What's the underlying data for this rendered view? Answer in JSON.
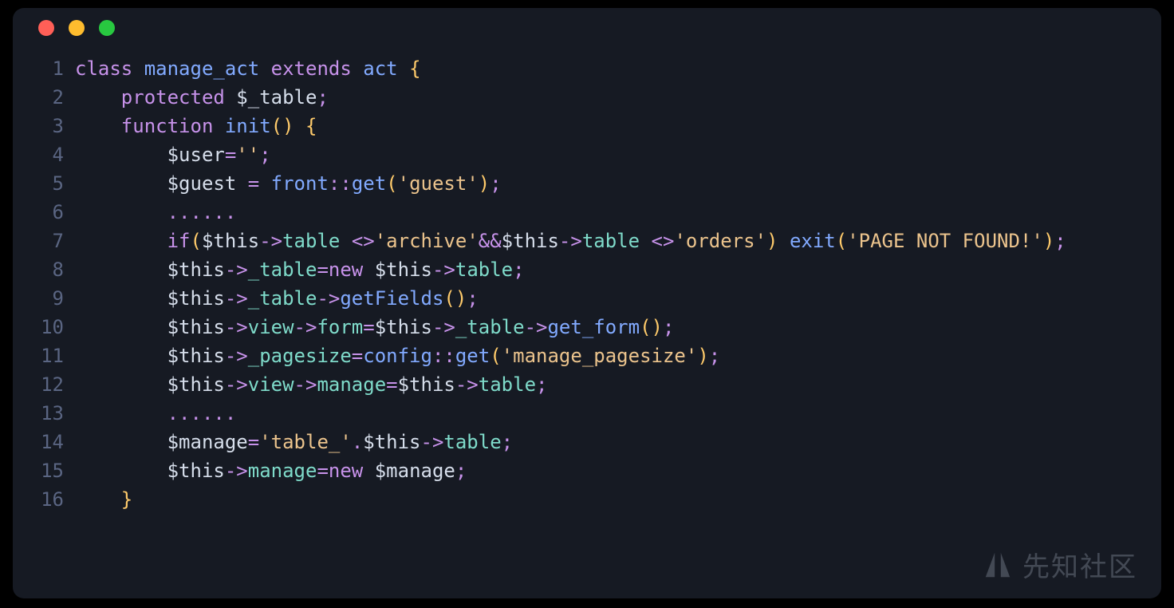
{
  "window": {
    "traffic_lights": [
      "red",
      "yellow",
      "green"
    ]
  },
  "watermark": {
    "text": "先知社区"
  },
  "code": {
    "language": "php",
    "lines": [
      {
        "n": 1,
        "indent": 0,
        "tokens": [
          {
            "c": "kw",
            "t": "class"
          },
          {
            "c": "plain",
            "t": " "
          },
          {
            "c": "name",
            "t": "manage_act"
          },
          {
            "c": "plain",
            "t": " "
          },
          {
            "c": "kw",
            "t": "extends"
          },
          {
            "c": "plain",
            "t": " "
          },
          {
            "c": "name",
            "t": "act"
          },
          {
            "c": "plain",
            "t": " "
          },
          {
            "c": "punct",
            "t": "{"
          }
        ]
      },
      {
        "n": 2,
        "indent": 1,
        "tokens": [
          {
            "c": "kw",
            "t": "protected"
          },
          {
            "c": "plain",
            "t": " "
          },
          {
            "c": "var",
            "t": "$_table"
          },
          {
            "c": "op",
            "t": ";"
          }
        ]
      },
      {
        "n": 3,
        "indent": 1,
        "tokens": [
          {
            "c": "kw",
            "t": "function"
          },
          {
            "c": "plain",
            "t": " "
          },
          {
            "c": "mname",
            "t": "init"
          },
          {
            "c": "punct",
            "t": "()"
          },
          {
            "c": "plain",
            "t": " "
          },
          {
            "c": "punct",
            "t": "{"
          }
        ]
      },
      {
        "n": 4,
        "indent": 2,
        "tokens": [
          {
            "c": "var",
            "t": "$user"
          },
          {
            "c": "op",
            "t": "="
          },
          {
            "c": "str",
            "t": "''"
          },
          {
            "c": "op",
            "t": ";"
          }
        ]
      },
      {
        "n": 5,
        "indent": 2,
        "tokens": [
          {
            "c": "var",
            "t": "$guest"
          },
          {
            "c": "plain",
            "t": " "
          },
          {
            "c": "op",
            "t": "="
          },
          {
            "c": "plain",
            "t": " "
          },
          {
            "c": "name",
            "t": "front"
          },
          {
            "c": "op",
            "t": "::"
          },
          {
            "c": "mname",
            "t": "get"
          },
          {
            "c": "punct",
            "t": "("
          },
          {
            "c": "str",
            "t": "'guest'"
          },
          {
            "c": "punct",
            "t": ")"
          },
          {
            "c": "op",
            "t": ";"
          }
        ]
      },
      {
        "n": 6,
        "indent": 2,
        "tokens": [
          {
            "c": "dots",
            "t": "......"
          }
        ]
      },
      {
        "n": 7,
        "indent": 2,
        "tokens": [
          {
            "c": "kw",
            "t": "if"
          },
          {
            "c": "punct",
            "t": "("
          },
          {
            "c": "var",
            "t": "$this"
          },
          {
            "c": "op",
            "t": "->"
          },
          {
            "c": "prop",
            "t": "table"
          },
          {
            "c": "plain",
            "t": " "
          },
          {
            "c": "op",
            "t": "<>"
          },
          {
            "c": "str",
            "t": "'archive'"
          },
          {
            "c": "op",
            "t": "&&"
          },
          {
            "c": "var",
            "t": "$this"
          },
          {
            "c": "op",
            "t": "->"
          },
          {
            "c": "prop",
            "t": "table"
          },
          {
            "c": "plain",
            "t": " "
          },
          {
            "c": "op",
            "t": "<>"
          },
          {
            "c": "str",
            "t": "'orders'"
          },
          {
            "c": "punct",
            "t": ")"
          },
          {
            "c": "plain",
            "t": " "
          },
          {
            "c": "mname",
            "t": "exit"
          },
          {
            "c": "punct",
            "t": "("
          },
          {
            "c": "str",
            "t": "'PAGE NOT FOUND!'"
          },
          {
            "c": "punct",
            "t": ")"
          },
          {
            "c": "op",
            "t": ";"
          }
        ]
      },
      {
        "n": 8,
        "indent": 2,
        "tokens": [
          {
            "c": "var",
            "t": "$this"
          },
          {
            "c": "op",
            "t": "->"
          },
          {
            "c": "prop",
            "t": "_table"
          },
          {
            "c": "op",
            "t": "="
          },
          {
            "c": "kw",
            "t": "new"
          },
          {
            "c": "plain",
            "t": " "
          },
          {
            "c": "var",
            "t": "$this"
          },
          {
            "c": "op",
            "t": "->"
          },
          {
            "c": "prop",
            "t": "table"
          },
          {
            "c": "op",
            "t": ";"
          }
        ]
      },
      {
        "n": 9,
        "indent": 2,
        "tokens": [
          {
            "c": "var",
            "t": "$this"
          },
          {
            "c": "op",
            "t": "->"
          },
          {
            "c": "prop",
            "t": "_table"
          },
          {
            "c": "op",
            "t": "->"
          },
          {
            "c": "mname",
            "t": "getFields"
          },
          {
            "c": "punct",
            "t": "()"
          },
          {
            "c": "op",
            "t": ";"
          }
        ]
      },
      {
        "n": 10,
        "indent": 2,
        "tokens": [
          {
            "c": "var",
            "t": "$this"
          },
          {
            "c": "op",
            "t": "->"
          },
          {
            "c": "prop",
            "t": "view"
          },
          {
            "c": "op",
            "t": "->"
          },
          {
            "c": "prop",
            "t": "form"
          },
          {
            "c": "op",
            "t": "="
          },
          {
            "c": "var",
            "t": "$this"
          },
          {
            "c": "op",
            "t": "->"
          },
          {
            "c": "prop",
            "t": "_table"
          },
          {
            "c": "op",
            "t": "->"
          },
          {
            "c": "mname",
            "t": "get_form"
          },
          {
            "c": "punct",
            "t": "()"
          },
          {
            "c": "op",
            "t": ";"
          }
        ]
      },
      {
        "n": 11,
        "indent": 2,
        "tokens": [
          {
            "c": "var",
            "t": "$this"
          },
          {
            "c": "op",
            "t": "->"
          },
          {
            "c": "prop",
            "t": "_pagesize"
          },
          {
            "c": "op",
            "t": "="
          },
          {
            "c": "name",
            "t": "config"
          },
          {
            "c": "op",
            "t": "::"
          },
          {
            "c": "mname",
            "t": "get"
          },
          {
            "c": "punct",
            "t": "("
          },
          {
            "c": "str",
            "t": "'manage_pagesize'"
          },
          {
            "c": "punct",
            "t": ")"
          },
          {
            "c": "op",
            "t": ";"
          }
        ]
      },
      {
        "n": 12,
        "indent": 2,
        "tokens": [
          {
            "c": "var",
            "t": "$this"
          },
          {
            "c": "op",
            "t": "->"
          },
          {
            "c": "prop",
            "t": "view"
          },
          {
            "c": "op",
            "t": "->"
          },
          {
            "c": "prop",
            "t": "manage"
          },
          {
            "c": "op",
            "t": "="
          },
          {
            "c": "var",
            "t": "$this"
          },
          {
            "c": "op",
            "t": "->"
          },
          {
            "c": "prop",
            "t": "table"
          },
          {
            "c": "op",
            "t": ";"
          }
        ]
      },
      {
        "n": 13,
        "indent": 2,
        "tokens": [
          {
            "c": "dots",
            "t": "......"
          }
        ]
      },
      {
        "n": 14,
        "indent": 2,
        "tokens": [
          {
            "c": "var",
            "t": "$manage"
          },
          {
            "c": "op",
            "t": "="
          },
          {
            "c": "str",
            "t": "'table_'"
          },
          {
            "c": "op",
            "t": "."
          },
          {
            "c": "var",
            "t": "$this"
          },
          {
            "c": "op",
            "t": "->"
          },
          {
            "c": "prop",
            "t": "table"
          },
          {
            "c": "op",
            "t": ";"
          }
        ]
      },
      {
        "n": 15,
        "indent": 2,
        "tokens": [
          {
            "c": "var",
            "t": "$this"
          },
          {
            "c": "op",
            "t": "->"
          },
          {
            "c": "prop",
            "t": "manage"
          },
          {
            "c": "op",
            "t": "="
          },
          {
            "c": "kw",
            "t": "new"
          },
          {
            "c": "plain",
            "t": " "
          },
          {
            "c": "var",
            "t": "$manage"
          },
          {
            "c": "op",
            "t": ";"
          }
        ]
      },
      {
        "n": 16,
        "indent": 1,
        "tokens": [
          {
            "c": "punct",
            "t": "}"
          }
        ]
      }
    ]
  }
}
